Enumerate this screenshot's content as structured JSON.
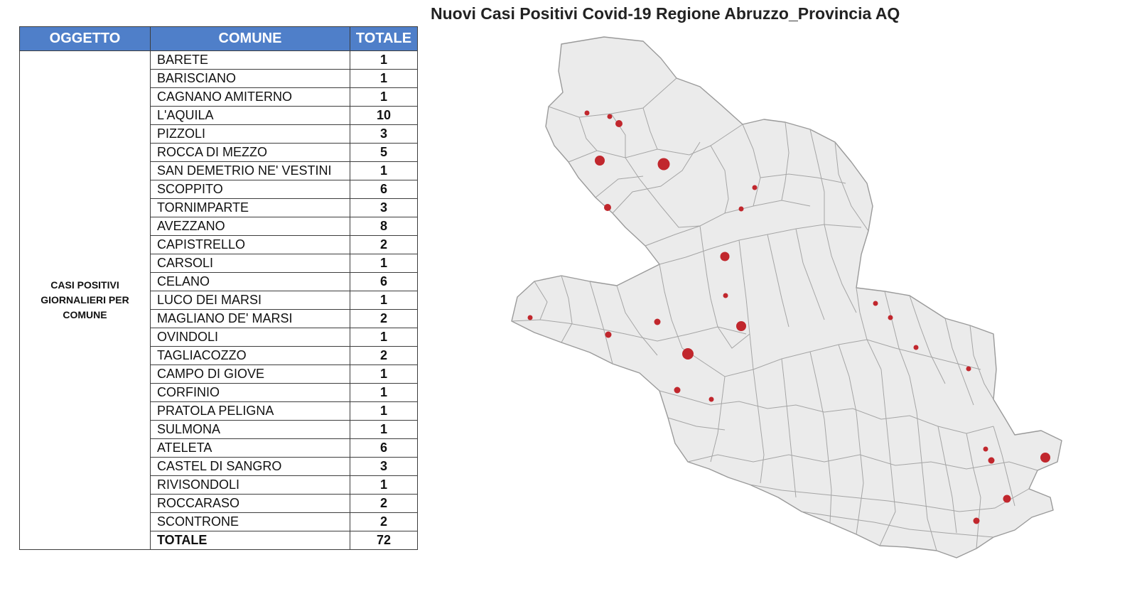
{
  "table": {
    "headers": {
      "oggetto": "OGGETTO",
      "comune": "COMUNE",
      "totale": "TOTALE"
    },
    "oggetto": "CASI POSITIVI GIORNALIERI PER COMUNE",
    "rows": [
      {
        "comune": "BARETE",
        "totale": "1"
      },
      {
        "comune": "BARISCIANO",
        "totale": "1"
      },
      {
        "comune": "CAGNANO AMITERNO",
        "totale": "1"
      },
      {
        "comune": "L'AQUILA",
        "totale": "10"
      },
      {
        "comune": "PIZZOLI",
        "totale": "3"
      },
      {
        "comune": "ROCCA DI MEZZO",
        "totale": "5"
      },
      {
        "comune": "SAN DEMETRIO NE' VESTINI",
        "totale": "1"
      },
      {
        "comune": "SCOPPITO",
        "totale": "6"
      },
      {
        "comune": "TORNIMPARTE",
        "totale": "3"
      },
      {
        "comune": "AVEZZANO",
        "totale": "8"
      },
      {
        "comune": "CAPISTRELLO",
        "totale": "2"
      },
      {
        "comune": "CARSOLI",
        "totale": "1"
      },
      {
        "comune": "CELANO",
        "totale": "6"
      },
      {
        "comune": "LUCO DEI MARSI",
        "totale": "1"
      },
      {
        "comune": "MAGLIANO DE' MARSI",
        "totale": "2"
      },
      {
        "comune": "OVINDOLI",
        "totale": "1"
      },
      {
        "comune": "TAGLIACOZZO",
        "totale": "2"
      },
      {
        "comune": "CAMPO DI GIOVE",
        "totale": "1"
      },
      {
        "comune": "CORFINIO",
        "totale": "1"
      },
      {
        "comune": "PRATOLA PELIGNA",
        "totale": "1"
      },
      {
        "comune": "SULMONA",
        "totale": "1"
      },
      {
        "comune": "ATELETA",
        "totale": "6"
      },
      {
        "comune": "CASTEL DI SANGRO",
        "totale": "3"
      },
      {
        "comune": "RIVISONDOLI",
        "totale": "1"
      },
      {
        "comune": "ROCCARASO",
        "totale": "2"
      },
      {
        "comune": "SCONTRONE",
        "totale": "2"
      }
    ],
    "total": {
      "label": "TOTALE",
      "value": "72"
    }
  },
  "map": {
    "title": "Nuovi Casi Positivi Covid-19 Regione Abruzzo_Provincia AQ",
    "colors": {
      "dot": "#c1272d",
      "fill": "#ebebeb",
      "header": "#4f7fc9"
    }
  }
}
